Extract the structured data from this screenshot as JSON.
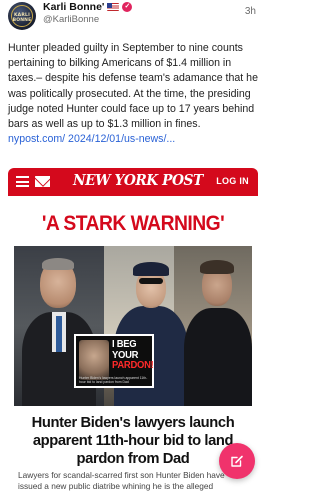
{
  "post": {
    "author_name": "Karli Bonne'",
    "handle": "@KarliBonne",
    "time": "3h",
    "avatar_text": "KARLI BONNE",
    "badges": [
      "flag-us-icon",
      "verified-icon"
    ],
    "text": "Hunter pleaded guilty in September to nine counts pertaining to bilking Americans of $1.4 million in taxes.– despite his defense team's adamance that he was politically prosecuted. At the time, the presiding judge noted Hunter could face up to 17 years behind bars as well as up to $1.3 million in fines. ",
    "link_text": "nypost.com/ 2024/12/01/us-news/..."
  },
  "card": {
    "brand": "NEW YORK POST",
    "login_label": "LOG IN",
    "headline_top": "'A STARK WARNING'",
    "inset_line1": "I BEG",
    "inset_line2": "YOUR",
    "inset_line3": "PARDON!",
    "inset_small": "Hunter Biden's lawyers launch apparent 11th-hour bid to land pardon from Dad",
    "headline_main": "Hunter Biden's lawyers launch apparent 11th-hour bid to land pardon from Dad",
    "subtext": "Lawyers for scandal-scarred first son Hunter Biden have issued a new public diatribe whining he is the alleged"
  },
  "fab": {
    "icon": "edit-icon"
  },
  "colors": {
    "nyp_red": "#d4091c",
    "link_blue": "#2a62d6",
    "fab_pink": "#f0336c"
  }
}
